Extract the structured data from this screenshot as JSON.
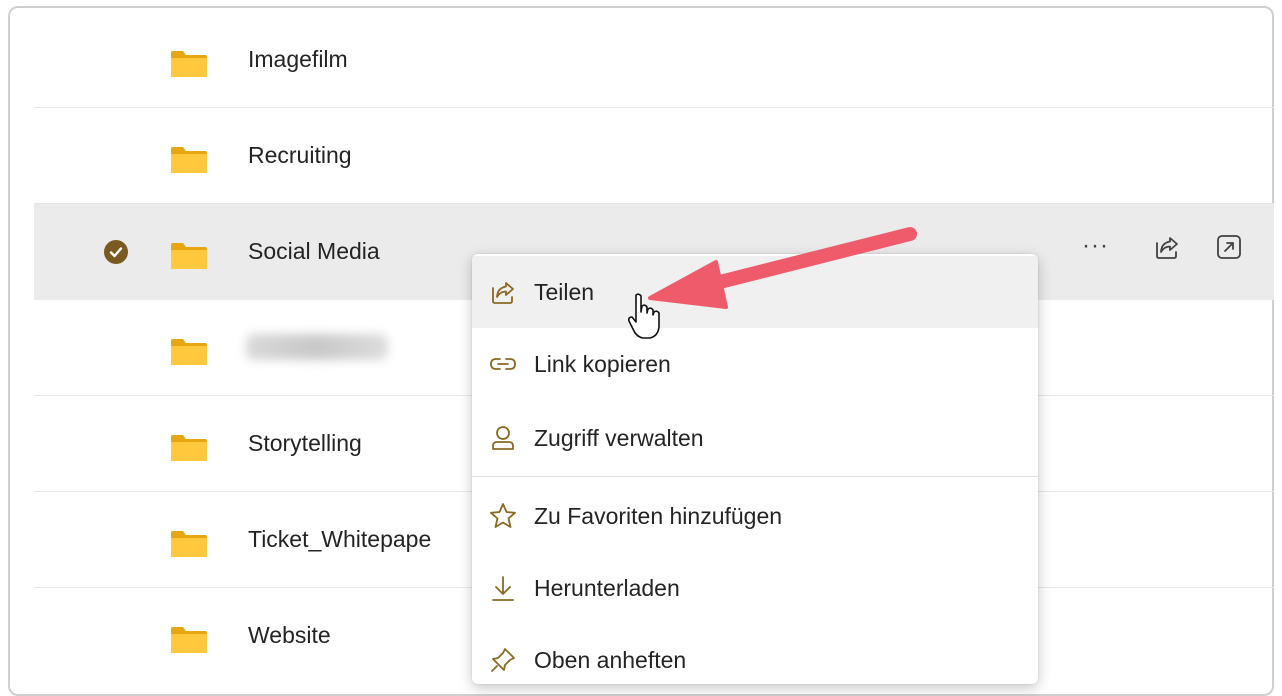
{
  "folders": [
    {
      "name": "Imagefilm",
      "selected": false
    },
    {
      "name": "Recruiting",
      "selected": false
    },
    {
      "name": "Social Media",
      "selected": true
    },
    {
      "name": "",
      "selected": false,
      "blurred": true
    },
    {
      "name": "Storytelling",
      "selected": false
    },
    {
      "name": "Ticket_Whitepape",
      "selected": false
    },
    {
      "name": "Website",
      "selected": false
    }
  ],
  "row_actions": {
    "more_label": "···",
    "share_icon": "share-icon",
    "open_icon": "open-in-new-icon"
  },
  "context_menu": {
    "items": [
      {
        "label": "Teilen",
        "icon": "share-icon"
      },
      {
        "label": "Link kopieren",
        "icon": "link-icon"
      },
      {
        "label": "Zugriff verwalten",
        "icon": "person-icon"
      },
      {
        "label": "Zu Favoriten hinzufügen",
        "icon": "star-icon"
      },
      {
        "label": "Herunterladen",
        "icon": "download-icon"
      },
      {
        "label": "Oben anheften",
        "icon": "pin-icon"
      }
    ]
  },
  "colors": {
    "accent": "#8a6a24",
    "folder": "#f5c518",
    "selected_row": "#ebebeb",
    "annotation_arrow": "#ef5b6b"
  }
}
